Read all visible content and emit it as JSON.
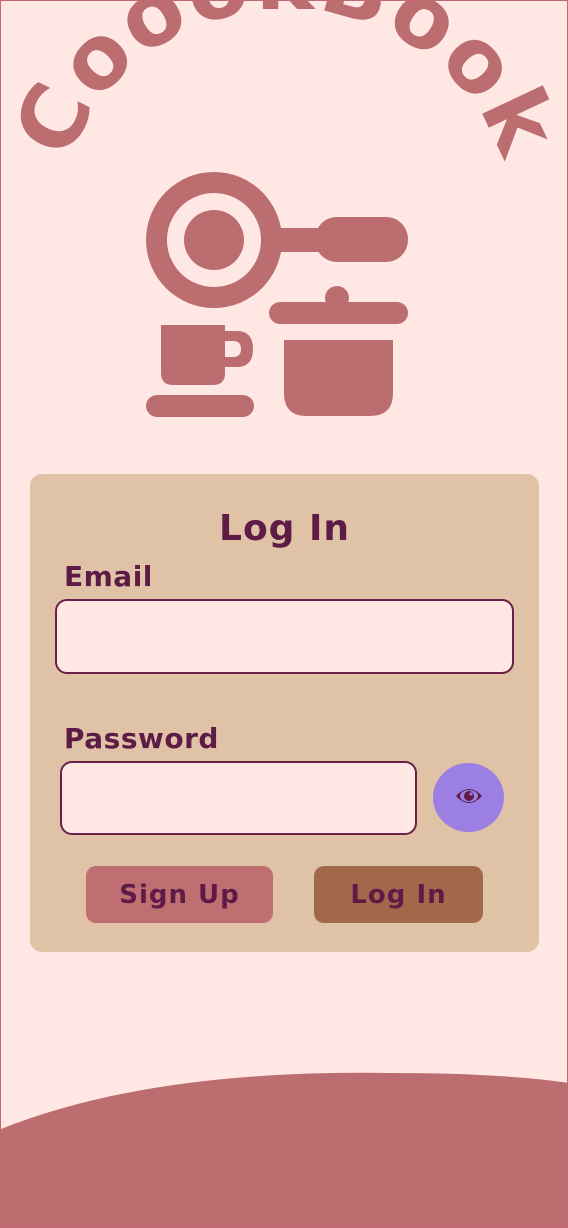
{
  "app": {
    "name": "CoookBook"
  },
  "form": {
    "title": "Log In",
    "email": {
      "label": "Email",
      "value": "",
      "placeholder": ""
    },
    "password": {
      "label": "Password",
      "value": "",
      "placeholder": ""
    },
    "toggle_visibility_icon": "eye-icon",
    "signup_label": "Sign Up",
    "login_label": "Log In"
  },
  "colors": {
    "background": "#ffe8e3",
    "accent_rose": "#bc6d70",
    "card": "#e0c2a6",
    "text_plum": "#5e1b45",
    "signup_button": "#bf6e71",
    "login_button": "#a1684b",
    "eye_button": "#9b7fe3"
  }
}
